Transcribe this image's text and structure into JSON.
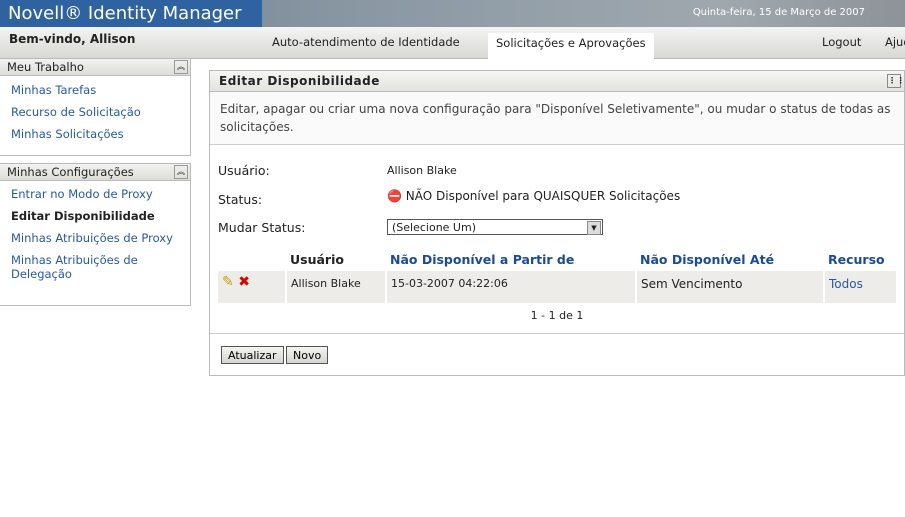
{
  "header": {
    "brand": "Novell® Identity Manager",
    "date": "Quinta-feira, 15 de Março de 2007",
    "welcome": "Bem-vindo, Allison",
    "tabs": [
      "Auto-atendimento de Identidade",
      "Solicitações e Aprovações"
    ],
    "logout": "Logout",
    "help": "Ajuda"
  },
  "sidebar": {
    "section1": {
      "title": "Meu Trabalho",
      "items": [
        "Minhas Tarefas",
        "Recurso de Solicitação",
        "Minhas Solicitações"
      ]
    },
    "section2": {
      "title": "Minhas Configurações",
      "items": [
        "Entrar no Modo de Proxy",
        "Editar Disponibilidade",
        "Minhas Atribuições de Proxy",
        "Minhas Atribuições de Delegação"
      ]
    }
  },
  "panel": {
    "title": "Editar Disponibilidade",
    "description": "Editar, apagar ou criar uma nova configuração para \"Disponível Seletivamente\", ou mudar o status de todas as solicitações.",
    "user_label": "Usuário:",
    "user_value": "Allison Blake",
    "status_label": "Status:",
    "status_value": "NÃO Disponível para QUAISQUER Solicitações",
    "change_label": "Mudar Status:",
    "change_value": "(Selecione Um)",
    "table": {
      "headers": [
        "Usuário",
        "Não Disponível a Partir de",
        "Não Disponível Até",
        "Recurso"
      ],
      "rows": [
        {
          "user": "Allison Blake",
          "from": "15-03-2007 04:22:06",
          "until": "Sem Vencimento",
          "resource": "Todos"
        }
      ]
    },
    "pager": "1 - 1 de 1",
    "refresh": "Atualizar",
    "new": "Novo"
  }
}
